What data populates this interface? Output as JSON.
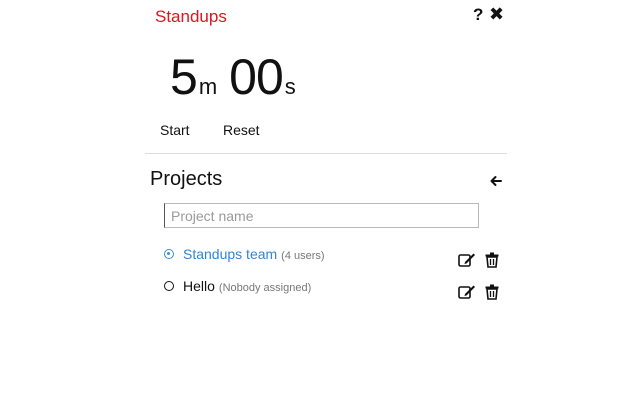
{
  "app": {
    "title": "Standups"
  },
  "header": {
    "help_icon": "?",
    "close_icon": "✖"
  },
  "timer": {
    "minutes": "5",
    "minutes_unit": "m",
    "seconds": "00",
    "seconds_unit": "s"
  },
  "controls": {
    "start_label": "Start",
    "reset_label": "Reset"
  },
  "projects": {
    "title": "Projects",
    "back_icon": "🡐",
    "input_placeholder": "Project name",
    "input_value": "",
    "items": [
      {
        "name": "Standups team",
        "meta": "(4 users)",
        "selected": true
      },
      {
        "name": "Hello",
        "meta": "(Nobody assigned)",
        "selected": false
      }
    ]
  },
  "colors": {
    "title_red": "#e0141e",
    "accent_blue": "#2f86d4"
  },
  "icons": [
    "help-icon",
    "close-icon",
    "back-arrow-icon",
    "radio-icon",
    "edit-icon",
    "trash-icon"
  ]
}
